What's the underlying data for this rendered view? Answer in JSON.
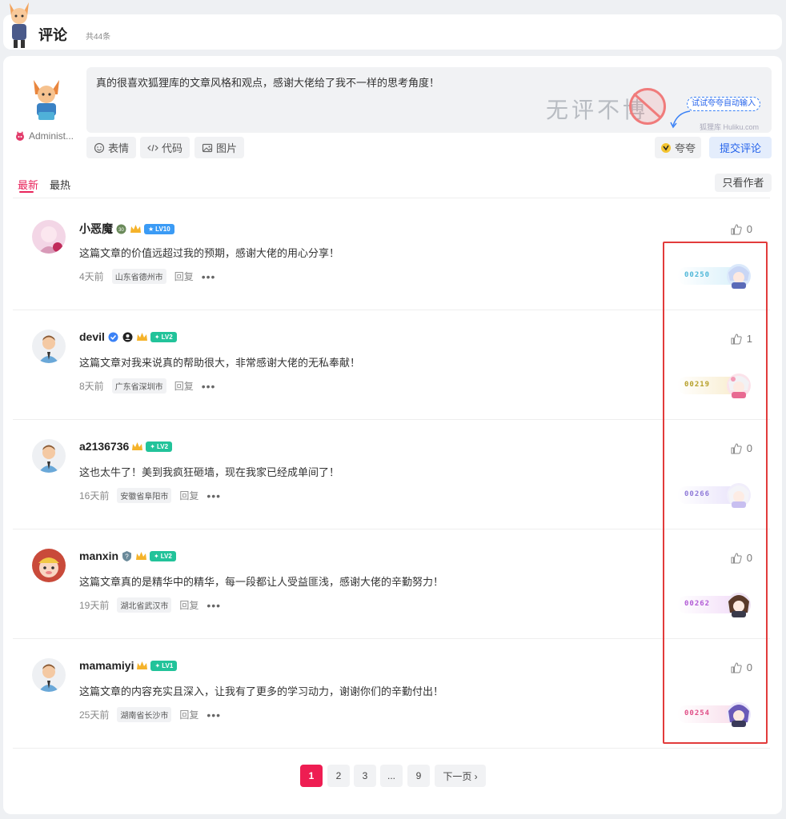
{
  "header": {
    "title": "评论",
    "count": "共44条"
  },
  "composer": {
    "text": "真的很喜欢狐狸库的文章风格和观点，感谢大佬给了我不一样的思考角度！",
    "watermark_text": "无评不博",
    "watermark_sub": "狐狸库 Huliku.com",
    "try_hint": "试试夸夸自动输入",
    "admin_name": "Administ...",
    "buttons": {
      "emoji": "表情",
      "code": "代码",
      "image": "图片",
      "kua": "夸夸",
      "submit": "提交评论"
    }
  },
  "tabs": {
    "newest": "最新",
    "hottest": "最热",
    "only_author": "只看作者"
  },
  "comments": [
    {
      "name": "小恶魔",
      "level": "LV10",
      "level_color": "#3b9bf5",
      "text": "这篇文章的价值远超过我的预期，感谢大佬的用心分享！",
      "time": "4天前",
      "location": "山东省德州市",
      "reply": "回复",
      "likes": "0",
      "badge_num": "00250",
      "badge_color": "#4fb7d8",
      "badge_bg": "#e3f4fb"
    },
    {
      "name": "devil",
      "level": "LV2",
      "level_color": "#22c39a",
      "text": "这篇文章对我来说真的帮助很大，非常感谢大佬的无私奉献！",
      "time": "8天前",
      "location": "广东省深圳市",
      "reply": "回复",
      "likes": "1",
      "badge_num": "00219",
      "badge_color": "#b6a02a",
      "badge_bg": "#fbf4dc"
    },
    {
      "name": "a2136736",
      "level": "LV2",
      "level_color": "#22c39a",
      "text": "这也太牛了！美到我疯狂砸墙，现在我家已经成单间了！",
      "time": "16天前",
      "location": "安徽省阜阳市",
      "reply": "回复",
      "likes": "0",
      "badge_num": "00266",
      "badge_color": "#8f7ad8",
      "badge_bg": "#eeeafb"
    },
    {
      "name": "manxin",
      "level": "LV2",
      "level_color": "#22c39a",
      "text": "这篇文章真的是精华中的精华，每一段都让人受益匪浅，感谢大佬的辛勤努力！",
      "time": "19天前",
      "location": "湖北省武汉市",
      "reply": "回复",
      "likes": "0",
      "badge_num": "00262",
      "badge_color": "#b25bd6",
      "badge_bg": "#f5e6fb"
    },
    {
      "name": "mamamiyi",
      "level": "LV1",
      "level_color": "#22c39a",
      "text": "这篇文章的内容充实且深入，让我有了更多的学习动力，谢谢你们的辛勤付出！",
      "time": "25天前",
      "location": "湖南省长沙市",
      "reply": "回复",
      "likes": "0",
      "badge_num": "00254",
      "badge_color": "#e05088",
      "badge_bg": "#fbe4ee"
    }
  ],
  "pagination": {
    "p1": "1",
    "p2": "2",
    "p3": "3",
    "dots": "...",
    "p9": "9",
    "next": "下一页 ›"
  }
}
